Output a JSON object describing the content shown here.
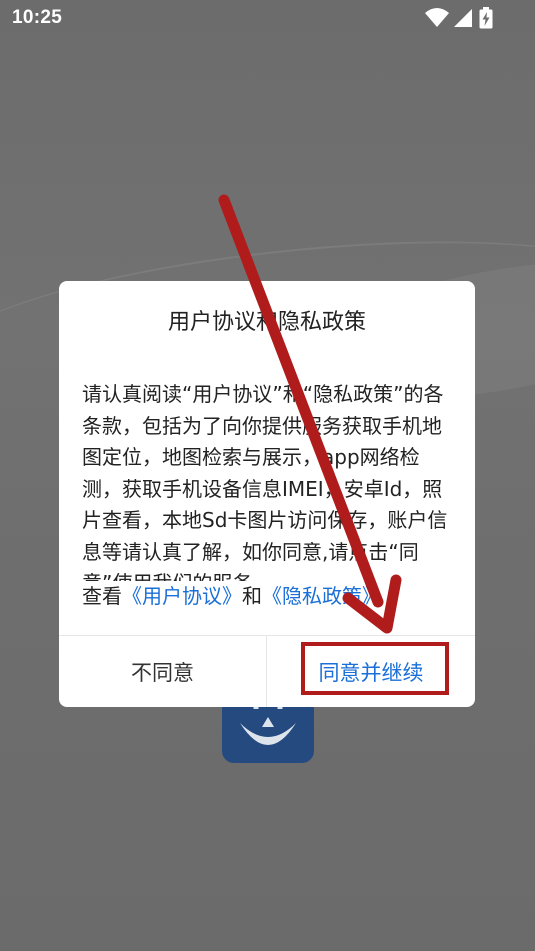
{
  "status_bar": {
    "time": "10:25",
    "icons": [
      "wifi-icon",
      "cellular-signal-icon",
      "battery-charging-icon"
    ]
  },
  "dialog": {
    "title": "用户协议和隐私政策",
    "body": "请认真阅读“用户协议”和“隐私政策”的各条款，包括为了向你提供服务获取手机地图定位，地图检索与展示，app网络检测，获取手机设备信息IMEI，安卓Id，照片查看，本地Sd卡图片访问保存，账户信息等请认真了解，如你同意,请点击“同意”使用我们的服务",
    "links_prefix": "查看",
    "link_user_agreement": "《用户协议》",
    "links_and": "和",
    "link_privacy_policy": "《隐私政策》",
    "disagree_label": "不同意",
    "agree_label": "同意并继续"
  },
  "colors": {
    "overlay_background": "#6f6f6f",
    "link": "#1a6fd8",
    "annotation_red": "#b01c1c",
    "logo_blue": "#244a80"
  }
}
